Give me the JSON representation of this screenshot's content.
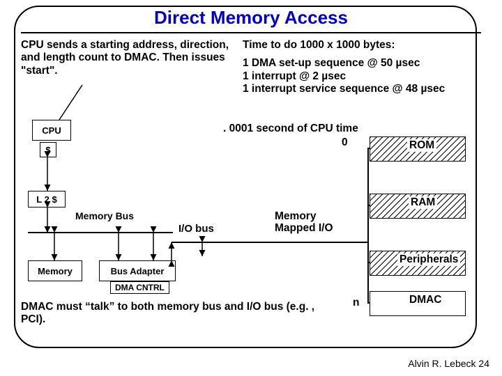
{
  "title": "Direct Memory Access",
  "left_desc": "CPU sends a starting address, direction,  and length count to DMAC. Then issues \"start\".",
  "right": {
    "heading": "Time to do 1000 x 1000 bytes:",
    "line1": "1 DMA set-up sequence @ 50 µsec",
    "line2": "1 interrupt @ 2 µsec",
    "line3": "1 interrupt service sequence @ 48 µsec"
  },
  "cpu_time": ". 0001 second of CPU time",
  "zero": "0",
  "boxes": {
    "cpu": "CPU",
    "cache": "$",
    "l2": "L 2 $",
    "memory": "Memory",
    "bus_adapter": "Bus Adapter",
    "dma_cntrl": "DMA CNTRL"
  },
  "labels": {
    "memory_bus": "Memory Bus",
    "io_bus": "I/O bus",
    "mmio": "Memory Mapped I/O",
    "rom": "ROM",
    "ram": "RAM",
    "peripherals": "Peripherals",
    "dmac": "DMAC",
    "n": "n"
  },
  "footer_note": "DMAC must “talk” to both memory bus and I/O bus (e.g. , PCI).",
  "attribution": "Alvin R. Lebeck 24"
}
